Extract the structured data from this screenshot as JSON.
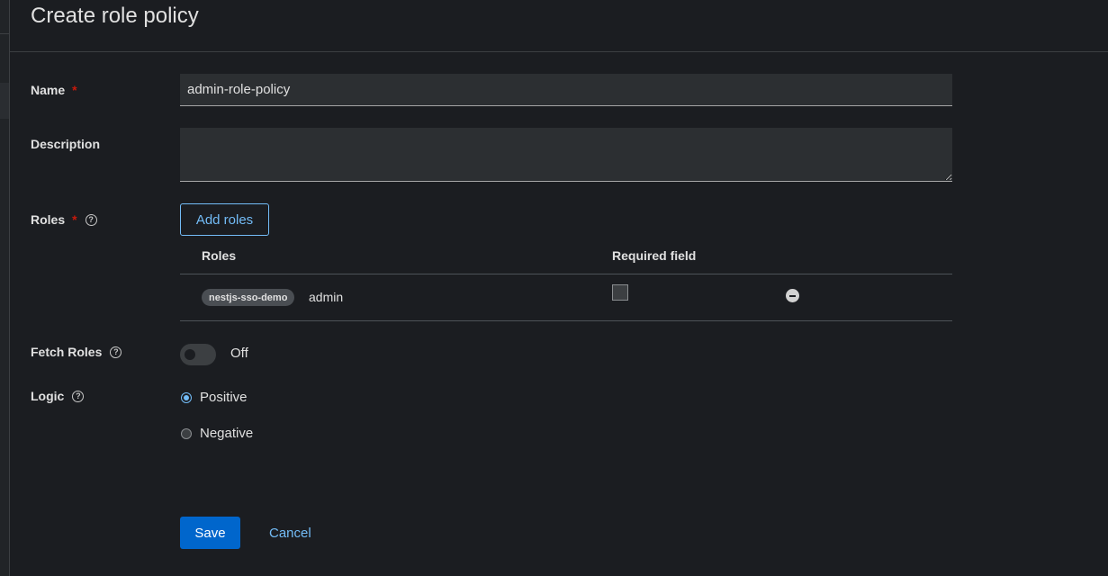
{
  "header": {
    "title": "Create role policy"
  },
  "form": {
    "name": {
      "label": "Name",
      "required": "*",
      "value": "admin-role-policy"
    },
    "description": {
      "label": "Description",
      "value": ""
    },
    "roles": {
      "label": "Roles",
      "required": "*",
      "add_button": "Add roles",
      "columns": [
        "Roles",
        "Required field"
      ],
      "rows": [
        {
          "client": "nestjs-sso-demo",
          "role": "admin",
          "required": false
        }
      ]
    },
    "fetch_roles": {
      "label": "Fetch Roles",
      "state": "Off"
    },
    "logic": {
      "label": "Logic",
      "options": [
        "Positive",
        "Negative"
      ],
      "selected": "Positive"
    }
  },
  "actions": {
    "save": "Save",
    "cancel": "Cancel"
  },
  "icons": {
    "help": "help-circle-icon",
    "remove": "minus-circle-icon",
    "help_glyph": "?"
  },
  "colors": {
    "accent": "#73bcf7",
    "primary": "#0066cc",
    "required": "#c9190b"
  }
}
